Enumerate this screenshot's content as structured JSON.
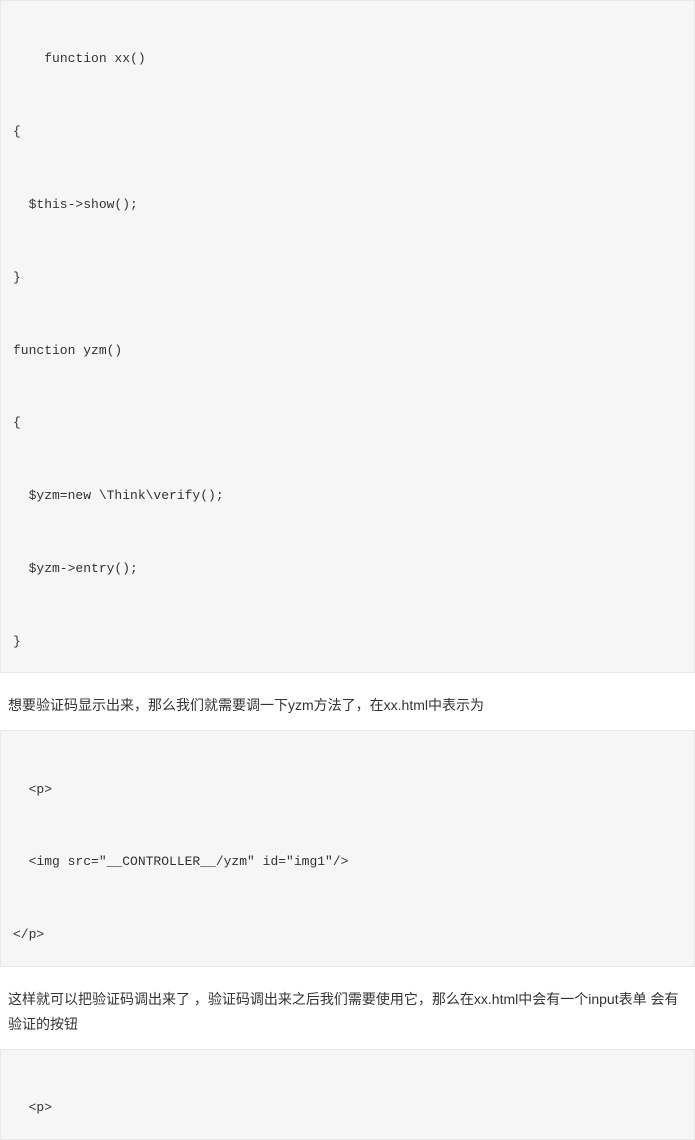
{
  "code1": {
    "lines": [
      "  function xx()",
      "",
      "{",
      "",
      "  $this->show();",
      "",
      "}",
      "",
      "function yzm()",
      "",
      "{",
      "",
      "  $yzm=new \\Think\\verify();",
      "",
      "  $yzm->entry();",
      "",
      "}"
    ]
  },
  "para1": "想要验证码显示出来，那么我们就需要调一下yzm方法了，在xx.html中表示为",
  "code2": {
    "lines": [
      "<p>",
      "",
      "  <img src=\"__CONTROLLER__/yzm\" id=\"img1\"/>",
      "",
      "</p>"
    ]
  },
  "para2": "这样就可以把验证码调出来了 ，验证码调出来之后我们需要使用它，那么在xx.html中会有一个input表单  会有验证的按钮",
  "code3": {
    "lines": [
      "<p>"
    ]
  }
}
